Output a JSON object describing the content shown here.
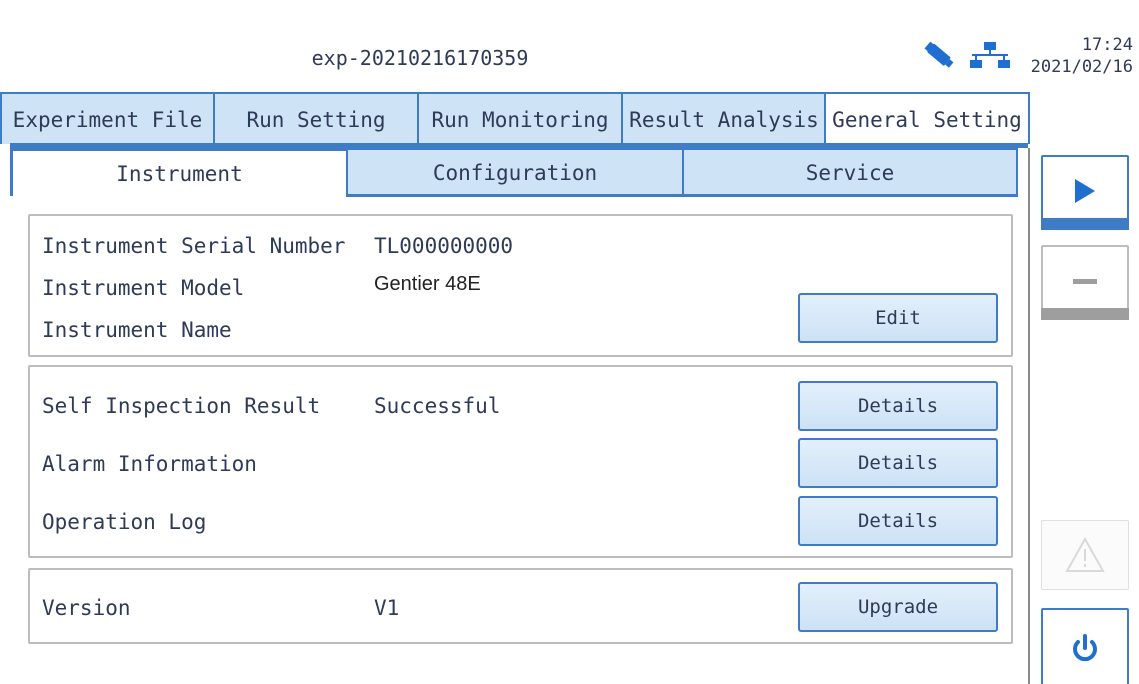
{
  "header": {
    "title": "exp-20210216170359",
    "time": "17:24",
    "date": "2021/02/16",
    "icons": [
      "usb-icon",
      "network-icon"
    ]
  },
  "main_tabs": [
    {
      "label": "Experiment File"
    },
    {
      "label": "Run Setting"
    },
    {
      "label": "Run Monitoring"
    },
    {
      "label": "Result Analysis"
    },
    {
      "label": "General Setting",
      "active": true
    }
  ],
  "sub_tabs": [
    {
      "label": "Instrument",
      "active": true
    },
    {
      "label": "Configuration"
    },
    {
      "label": "Service"
    }
  ],
  "instrument_info": {
    "serial_label": "Instrument Serial Number",
    "serial_value": "TL000000000",
    "model_label": "Instrument Model",
    "model_value": "Gentier 48E",
    "name_label": "Instrument Name",
    "name_value": "",
    "edit_label": "Edit"
  },
  "status_info": {
    "self_inspection_label": "Self Inspection Result",
    "self_inspection_value": "Successful",
    "alarm_label": "Alarm Information",
    "operation_log_label": "Operation Log",
    "details_label": "Details"
  },
  "version_info": {
    "version_label": "Version",
    "version_value": "V1",
    "upgrade_label": "Upgrade"
  },
  "side_buttons": [
    "play-icon",
    "stop-icon",
    "warning-icon",
    "power-icon"
  ],
  "colors": {
    "accent": "#3e7cc6",
    "tab_fill": "#cfe3f6",
    "text": "#2e3a57"
  }
}
